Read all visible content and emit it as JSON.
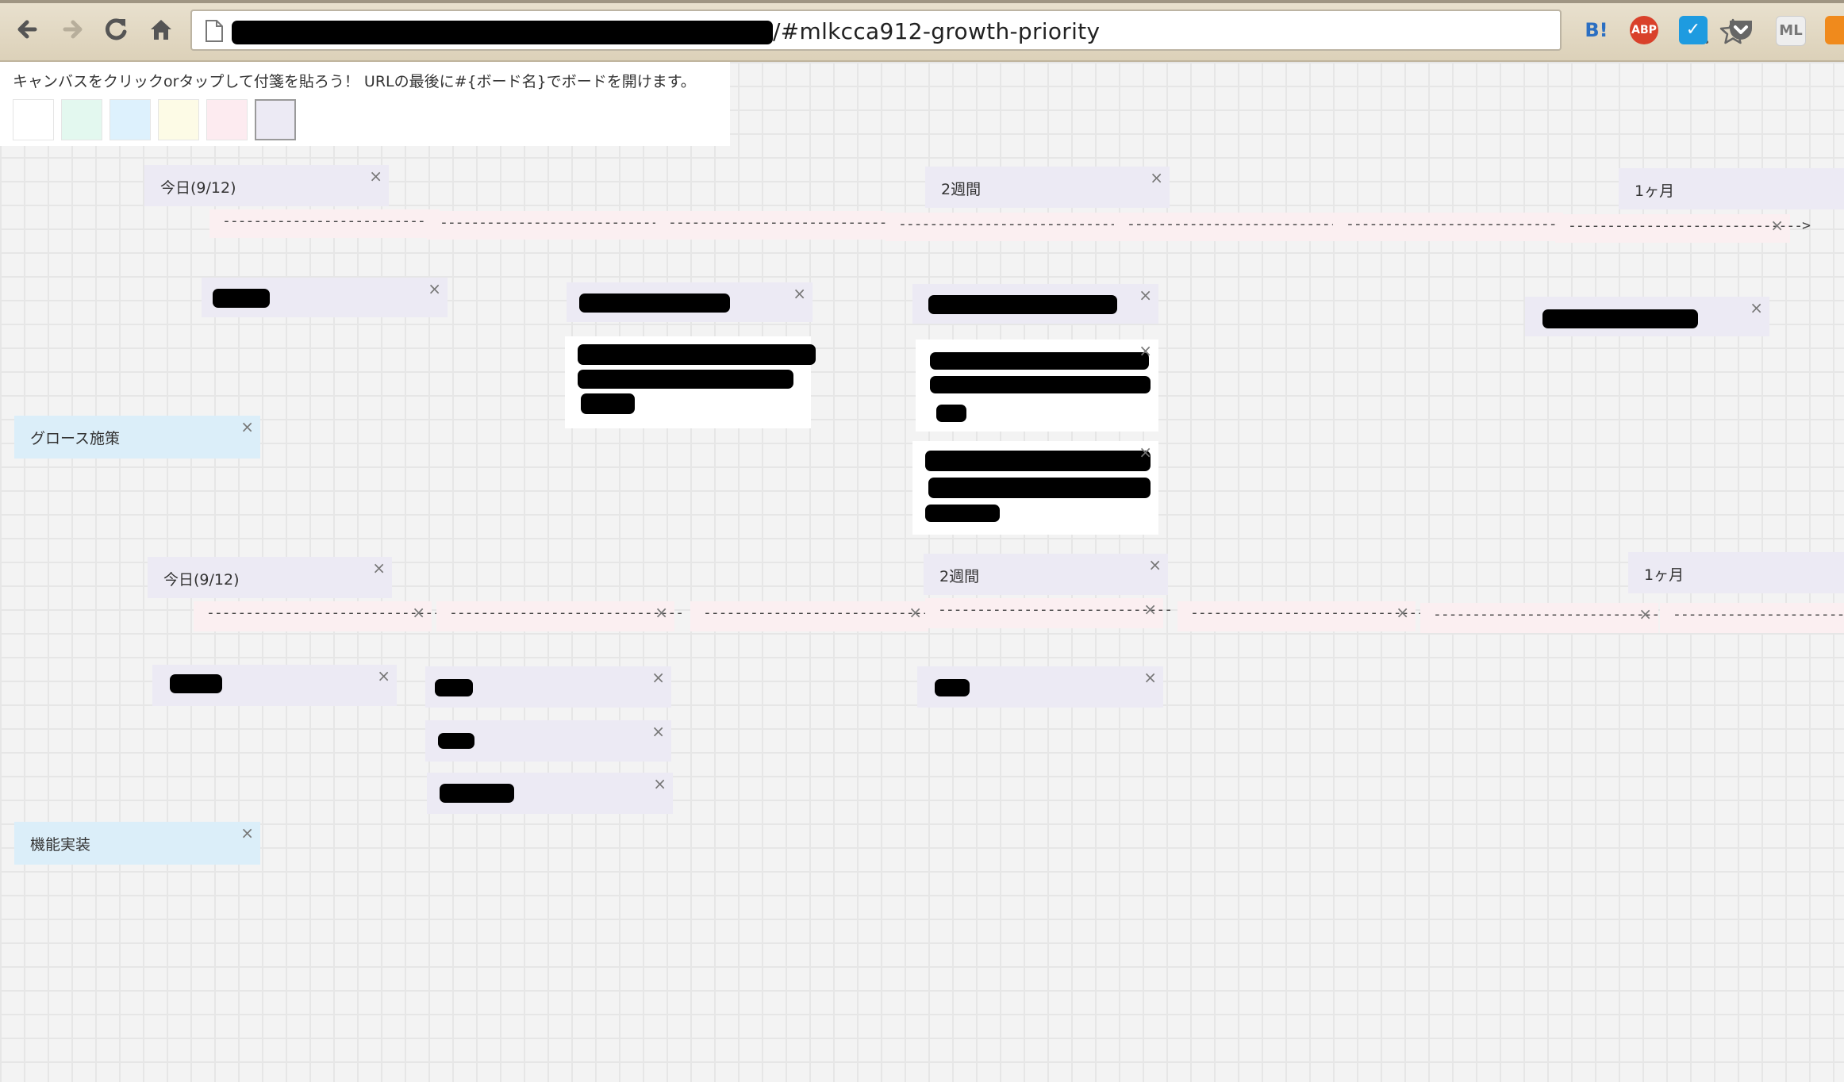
{
  "browser": {
    "url_tail": "/#mlkcca912-growth-priority",
    "extensions": [
      {
        "name": "hatena-bookmark-icon",
        "label": "B!",
        "color": "#2b6fc2"
      },
      {
        "name": "adblock-plus-icon",
        "label": "ABP",
        "color": "#d9412b"
      },
      {
        "name": "todo-check-icon",
        "label": "✓",
        "color": "#1e9be0"
      },
      {
        "name": "pocket-icon",
        "label": "",
        "color": "#666666"
      },
      {
        "name": "ml-icon",
        "label": "ML",
        "color": "#cccccc"
      }
    ]
  },
  "board": {
    "hint": "キャンバスをクリックorタップして付箋を貼ろう！ URLの最後に#{ボード名}でボードを開けます。",
    "colors": [
      "#ffffff",
      "#e3f8ef",
      "#ddf1fd",
      "#fdfbe6",
      "#fdebf0",
      "#eceaf4"
    ],
    "close_glyph": "×"
  },
  "notes": {
    "today_1": "今日(9/12)",
    "two_weeks_1": "2週間",
    "one_month_1": "1ヶ月",
    "growth": "グロース施策",
    "today_2": "今日(9/12)",
    "two_weeks_2": "2週間",
    "one_month_2": "1ヶ月",
    "features": "機能実装"
  },
  "timeline": {
    "dash": "------------------------------",
    "arrow_end": "------------------------------>"
  }
}
